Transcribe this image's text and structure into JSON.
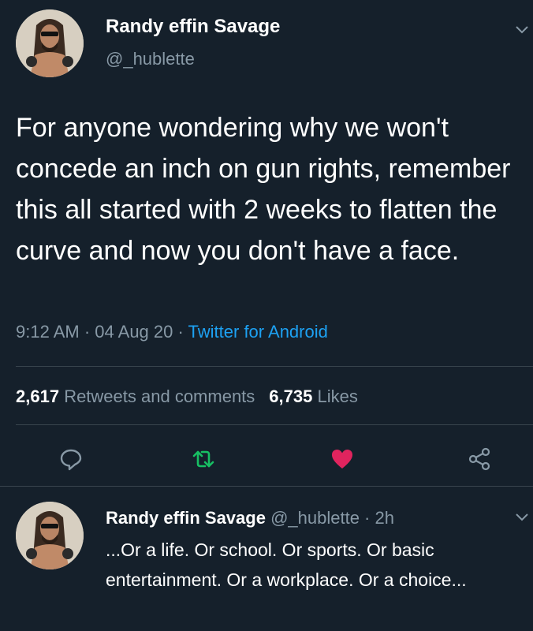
{
  "tweet": {
    "display_name": "Randy effin Savage",
    "handle": "@_hublette",
    "text": "For anyone wondering why we won't concede an inch on gun rights, remember this all started with 2 weeks to flatten the curve and now you don't have a face.",
    "time": "9:12 AM",
    "separator": " · ",
    "date": "04 Aug 20",
    "source": "Twitter for Android",
    "retweets_count": "2,617",
    "retweets_label": "Retweets and comments",
    "likes_count": "6,735",
    "likes_label": "Likes"
  },
  "actions": {
    "reply_icon": "speech-bubble-icon",
    "retweet_icon": "retweet-arrows-icon",
    "like_icon": "heart-icon",
    "share_icon": "share-nodes-icon"
  },
  "reply": {
    "display_name": "Randy effin Savage",
    "handle": "@_hublette",
    "separator": " · ",
    "age": "2h",
    "text": "...Or a life. Or school. Or sports. Or basic entertainment. Or a workplace. Or a choice..."
  },
  "colors": {
    "background": "#15202b",
    "text": "#ffffff",
    "secondary": "#8899a6",
    "link": "#1da1f2",
    "retweet": "#17bf63",
    "like": "#e0245e",
    "divider": "#38444d"
  }
}
